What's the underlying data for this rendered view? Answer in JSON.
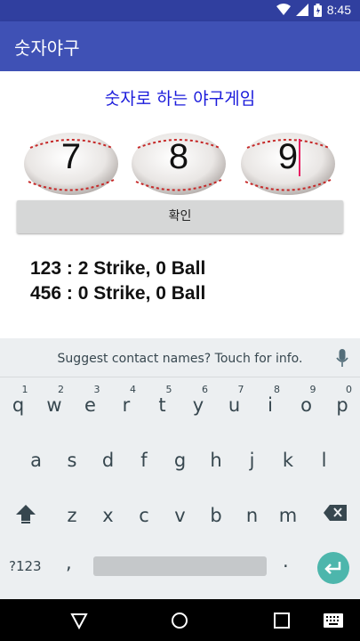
{
  "status_bar": {
    "time": "8:45"
  },
  "app_bar": {
    "title": "숫자야구"
  },
  "main": {
    "heading": "숫자로 하는 야구게임",
    "digits": [
      "7",
      "8",
      "9"
    ],
    "confirm_label": "확인",
    "results": [
      "123  : 2 Strike, 0 Ball",
      "456  : 0 Strike, 0 Ball"
    ]
  },
  "keyboard": {
    "suggestion": "Suggest contact names? Touch for info.",
    "row1": [
      {
        "k": "q",
        "n": "1"
      },
      {
        "k": "w",
        "n": "2"
      },
      {
        "k": "e",
        "n": "3"
      },
      {
        "k": "r",
        "n": "4"
      },
      {
        "k": "t",
        "n": "5"
      },
      {
        "k": "y",
        "n": "6"
      },
      {
        "k": "u",
        "n": "7"
      },
      {
        "k": "i",
        "n": "8"
      },
      {
        "k": "o",
        "n": "9"
      },
      {
        "k": "p",
        "n": "0"
      }
    ],
    "row2": [
      "a",
      "s",
      "d",
      "f",
      "g",
      "h",
      "j",
      "k",
      "l"
    ],
    "row3": [
      "z",
      "x",
      "c",
      "v",
      "b",
      "n",
      "m"
    ],
    "symbols_label": "?123",
    "comma": ",",
    "period": "."
  }
}
